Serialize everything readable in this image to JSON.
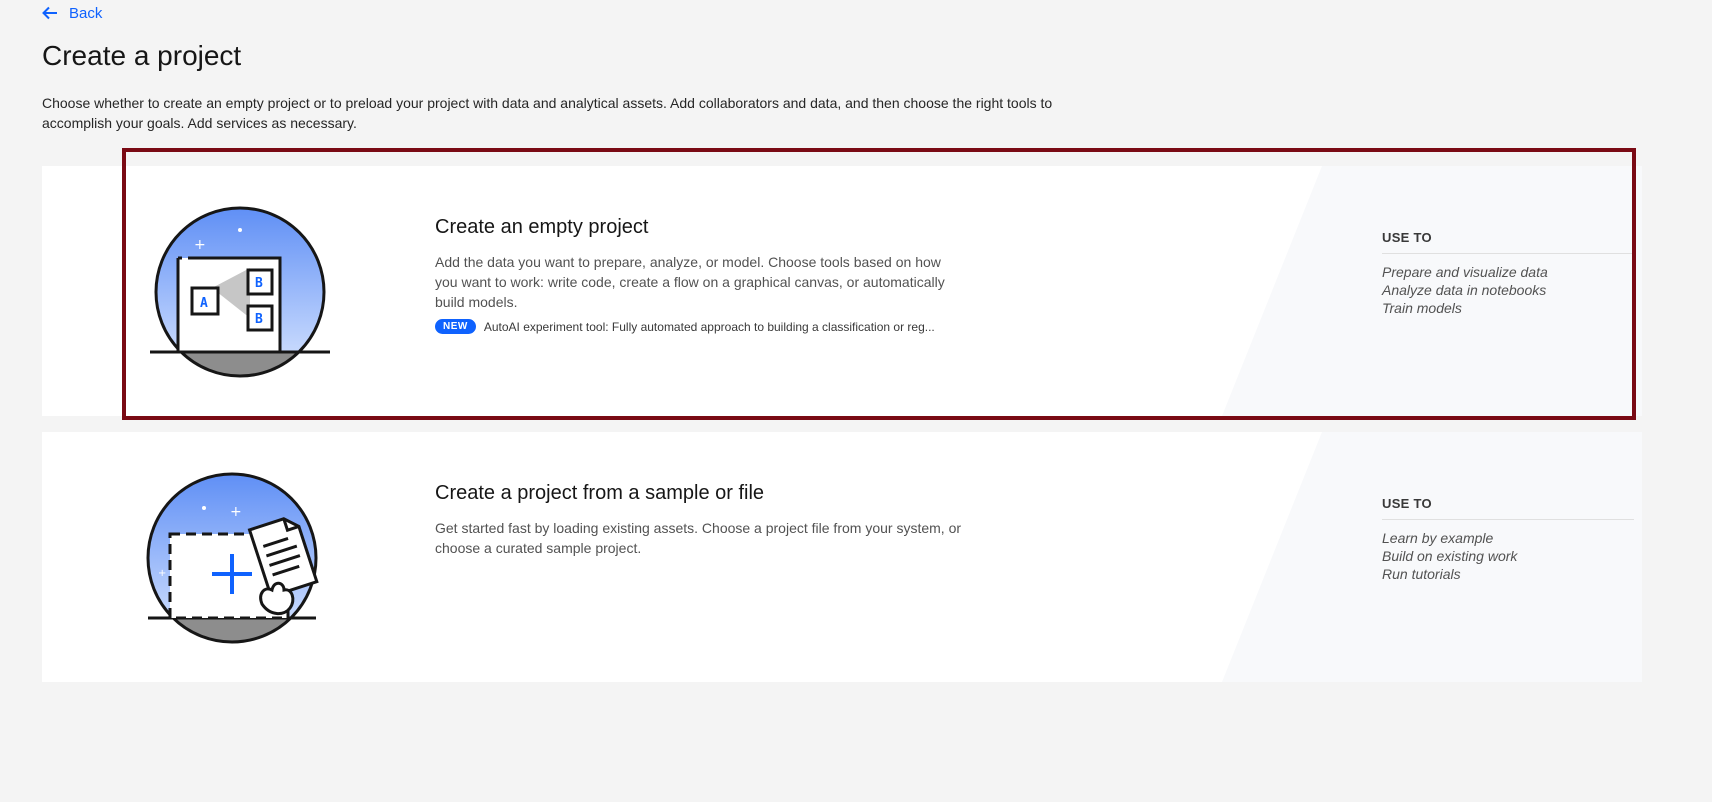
{
  "nav": {
    "back_label": "Back"
  },
  "page": {
    "title": "Create a project",
    "description": "Choose whether to create an empty project or to preload your project with data and analytical assets. Add collaborators and data, and then choose the right tools to accomplish your goals. Add services as necessary."
  },
  "cards": [
    {
      "title": "Create an empty project",
      "description": "Add the data you want to prepare, analyze, or model. Choose tools based on how you want to work: write code, create a flow on a graphical canvas, or automatically build models.",
      "badge": "NEW",
      "badge_text": "AutoAI experiment tool: Fully automated approach to building a classification or reg...",
      "use_to_label": "USE TO",
      "use_to_items": [
        "Prepare and visualize data",
        "Analyze data in notebooks",
        "Train models"
      ],
      "illustration_icon": "empty-project-illustration-icon",
      "illustration_letters": [
        "A",
        "B",
        "B"
      ]
    },
    {
      "title": "Create a project from a sample or file",
      "description": "Get started fast by loading existing assets. Choose a project file from your system, or choose a curated sample project.",
      "use_to_label": "USE TO",
      "use_to_items": [
        "Learn by example",
        "Build on existing work",
        "Run tutorials"
      ],
      "illustration_icon": "sample-project-illustration-icon"
    }
  ],
  "colors": {
    "accent": "#0f62fe",
    "highlight_border": "#7a0a14",
    "background": "#f4f4f4",
    "card": "#ffffff"
  }
}
